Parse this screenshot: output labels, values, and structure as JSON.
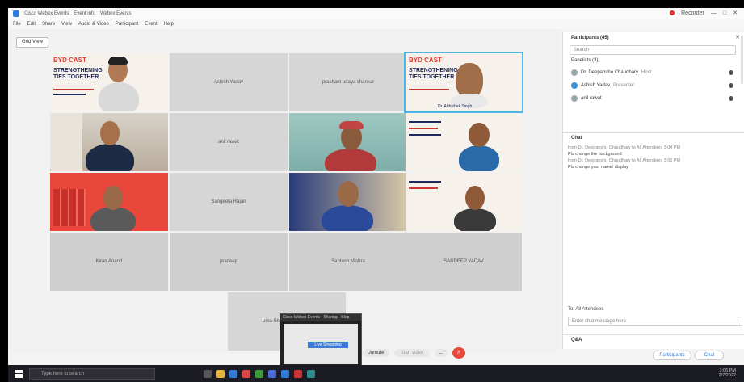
{
  "titlebar": {
    "tab_main": "Cisco Webex Events",
    "tab_2": "Event info",
    "tab_3": "Webex Events",
    "recorder": "Recorder"
  },
  "menu": [
    "File",
    "Edit",
    "Share",
    "View",
    "Audio & Video",
    "Participant",
    "Event",
    "Help"
  ],
  "layout_button": "Grid View",
  "tiles": {
    "ashish": "Ashish Yadav",
    "prashant": "prashant udaya shankar",
    "anil": "anil rawat",
    "sangeeta": "Sangeeta Rajan",
    "kiran": "Kiran Anand",
    "pradeep": "pradeep",
    "santosh": "Santosh Mishra",
    "sandeep": "SANDEEP YADAV",
    "bottom": "uma Shanker Shankar"
  },
  "poster": {
    "brand": "BYD CAST",
    "headline": "STRENGTHENING TIES TOGETHER",
    "caption": "Dr. Abhishek Singh"
  },
  "panel": {
    "participants_title": "Participants (45)",
    "search_placeholder": "Search",
    "panelists_header": "Panelists (3)",
    "participants": [
      {
        "name": "Dr. Deepanshu Chaudhary",
        "role": "Host"
      },
      {
        "name": "Ashish Yadav",
        "role": "Presenter"
      },
      {
        "name": "anil rawat",
        "role": ""
      }
    ],
    "chat_title": "Chat",
    "chat_messages": [
      "from Dr. Deepanshu Chaudhary to All Attendees 3:04 PM",
      "Pls change the background",
      "from Dr. Deepanshu Chaudhary to All Attendees 3:05 PM",
      "Pls change your name/ display"
    ],
    "chat_to": "All Attendees",
    "chat_input_placeholder": "Enter chat message here",
    "qa_title": "Q&A",
    "participants_btn": "Participants",
    "chat_btn": "Chat"
  },
  "controls": {
    "unmute": "Unmute",
    "start_video": "Start video",
    "more": "...",
    "end": "X"
  },
  "popup": {
    "title": "Cisco Webex Events - Sharing - Stop",
    "status": "Live Streaming"
  },
  "taskbar": {
    "search_placeholder": "Type here to search",
    "time": "3:06 PM",
    "date": "2/7/2022"
  },
  "colors": {
    "accent": "#4cb7e6",
    "brand_red": "#e03c31",
    "end_red": "#e8473b"
  }
}
